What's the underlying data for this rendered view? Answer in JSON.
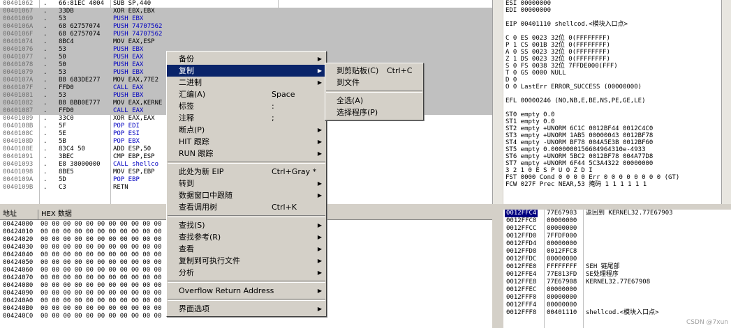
{
  "disasm": {
    "rows": [
      {
        "addr": "00401062",
        "m": ".",
        "hex": "66:81EC 4004",
        "asm": "SUB SP,440",
        "c": "",
        "hl": false
      },
      {
        "addr": "00401067",
        "m": ".",
        "hex": "33DB",
        "asm": "XOR EBX,EBX",
        "c": "",
        "hl": true
      },
      {
        "addr": "00401069",
        "m": ".",
        "hex": "53",
        "asm": "PUSH EBX",
        "c": "blue",
        "hl": true
      },
      {
        "addr": "0040106A",
        "m": ".",
        "hex": "68 62757074",
        "asm": "PUSH 74707562",
        "c": "blue",
        "hl": true
      },
      {
        "addr": "0040106F",
        "m": ".",
        "hex": "68 62757074",
        "asm": "PUSH 74707562",
        "c": "blue",
        "hl": true
      },
      {
        "addr": "00401074",
        "m": ".",
        "hex": "8BC4",
        "asm": "MOV EAX,ESP",
        "c": "",
        "hl": true
      },
      {
        "addr": "00401076",
        "m": ".",
        "hex": "53",
        "asm": "PUSH EBX",
        "c": "blue",
        "hl": true
      },
      {
        "addr": "00401077",
        "m": ".",
        "hex": "50",
        "asm": "PUSH EAX",
        "c": "blue",
        "hl": true
      },
      {
        "addr": "00401078",
        "m": ".",
        "hex": "50",
        "asm": "PUSH EAX",
        "c": "blue",
        "hl": true
      },
      {
        "addr": "00401079",
        "m": ".",
        "hex": "53",
        "asm": "PUSH EBX",
        "c": "blue",
        "hl": true
      },
      {
        "addr": "0040107A",
        "m": ".",
        "hex": "B8 683DE277",
        "asm": "MOV EAX,77E2",
        "c": "",
        "hl": true
      },
      {
        "addr": "0040107F",
        "m": ".",
        "hex": "FFD0",
        "asm": "CALL EAX",
        "c": "blue",
        "hl": true
      },
      {
        "addr": "00401081",
        "m": ".",
        "hex": "53",
        "asm": "PUSH EBX",
        "c": "blue",
        "hl": true
      },
      {
        "addr": "00401082",
        "m": ".",
        "hex": "B8 BBB0E777",
        "asm": "MOV EAX,KERNE",
        "c": "",
        "hl": true
      },
      {
        "addr": "00401087",
        "m": ".",
        "hex": "FFD0",
        "asm": "CALL EAX",
        "c": "blue",
        "hl": true
      },
      {
        "addr": "00401089",
        "m": ".",
        "hex": "33C0",
        "asm": "XOR EAX,EAX",
        "c": "",
        "hl": false
      },
      {
        "addr": "0040108B",
        "m": ".",
        "hex": "5F",
        "asm": "POP EDI",
        "c": "blue",
        "hl": false
      },
      {
        "addr": "0040108C",
        "m": ".",
        "hex": "5E",
        "asm": "POP ESI",
        "c": "blue",
        "hl": false
      },
      {
        "addr": "0040108D",
        "m": ".",
        "hex": "5B",
        "asm": "POP EBX",
        "c": "blue",
        "hl": false
      },
      {
        "addr": "0040108E",
        "m": ".",
        "hex": "83C4 50",
        "asm": "ADD ESP,50",
        "c": "",
        "hl": false
      },
      {
        "addr": "00401091",
        "m": ".",
        "hex": "3BEC",
        "asm": "CMP EBP,ESP",
        "c": "",
        "hl": false
      },
      {
        "addr": "00401093",
        "m": ".",
        "hex": "E8 38000000",
        "asm": "CALL shellco",
        "c": "blue",
        "hl": false
      },
      {
        "addr": "00401098",
        "m": ".",
        "hex": "8BE5",
        "asm": "MOV ESP,EBP",
        "c": "",
        "hl": false
      },
      {
        "addr": "0040109A",
        "m": ".",
        "hex": "5D",
        "asm": "POP EBP",
        "c": "blue",
        "hl": false
      },
      {
        "addr": "0040109B",
        "m": ".",
        "hex": "C3",
        "asm": "RETN",
        "c": "",
        "hl": false
      }
    ]
  },
  "registers": {
    "lines": [
      {
        "t": "ESI 00000000",
        "c": ""
      },
      {
        "t": "EDI 00000000",
        "c": ""
      },
      {
        "t": "",
        "c": ""
      },
      {
        "t": "EIP 00401110 shellcod.<模块入口点>",
        "c": ""
      },
      {
        "t": "",
        "c": ""
      },
      {
        "t": "C 0  ES 0023 32位 0(FFFFFFFF)",
        "c": ""
      },
      {
        "t": "P 1  CS 001B 32位 0(FFFFFFFF)",
        "c": ""
      },
      {
        "t": "A 0  SS 0023 32位 0(FFFFFFFF)",
        "c": ""
      },
      {
        "t": "Z 1  DS 0023 32位 0(FFFFFFFF)",
        "c": ""
      },
      {
        "t": "S 0  FS 0038 32位 7FFDE000(FFF)",
        "c": ""
      },
      {
        "t": "T 0  GS 0000 NULL",
        "c": ""
      },
      {
        "t": "D 0",
        "c": ""
      },
      {
        "t": "O 0  LastErr ERROR_SUCCESS (00000000)",
        "c": ""
      },
      {
        "t": "",
        "c": ""
      },
      {
        "t": "EFL 00000246 (NO,NB,E,BE,NS,PE,GE,LE)",
        "c": ""
      },
      {
        "t": "",
        "c": ""
      },
      {
        "t": "ST0 empty 0.0",
        "c": ""
      },
      {
        "t": "ST1 empty 0.0",
        "c": ""
      },
      {
        "t": "ST2 empty +UNORM 6C1C 0012BF44 0012C4C0",
        "c": ""
      },
      {
        "t": "ST3 empty +UNORM 1AB5 00000043 0012BF78",
        "c": ""
      },
      {
        "t": "ST4 empty -UNORM BF78 004A5E3B 0012BF60",
        "c": ""
      },
      {
        "t": "ST5 empty 0.0000000156604964310e-4933",
        "c": ""
      },
      {
        "t": "ST6 empty +UNORM 5BC2 0012BF78 004A77D8",
        "c": ""
      },
      {
        "t": "ST7 empty +UNORM 6F44 5C3A4322 00000000",
        "c": ""
      },
      {
        "t": "               3 2 1 0      E S P U O Z D I",
        "c": ""
      },
      {
        "t": "FST 0000  Cond 0 0 0 0  Err 0 0 0 0 0 0 0 0  (GT)",
        "c": ""
      },
      {
        "t": "FCW 027F  Prec NEAR,53  掩码    1 1 1 1 1 1",
        "c": ""
      }
    ]
  },
  "dump": {
    "header_addr": "地址",
    "header_hex": "HEX 数据",
    "rows": [
      {
        "addr": "00424000",
        "hex": "00 00 00 00 00 00 00 00 00 00 00"
      },
      {
        "addr": "00424010",
        "hex": "00 00 00 00 00 00 00 00 00 00 00"
      },
      {
        "addr": "00424020",
        "hex": "00 00 00 00 00 00 00 00 00 00 00"
      },
      {
        "addr": "00424030",
        "hex": "00 00 00 00 00 00 00 00 00 00 00"
      },
      {
        "addr": "00424040",
        "hex": "00 00 00 00 00 00 00 00 00 00 00"
      },
      {
        "addr": "00424050",
        "hex": "00 00 00 00 00 00 00 00 00 00 00"
      },
      {
        "addr": "00424060",
        "hex": "00 00 00 00 00 00 00 00 00 00 00"
      },
      {
        "addr": "00424070",
        "hex": "00 00 00 00 00 00 00 00 00 00 00"
      },
      {
        "addr": "00424080",
        "hex": "00 00 00 00 00 00 00 00 00 00 00"
      },
      {
        "addr": "00424090",
        "hex": "00 00 00 00 00 00 00 00 00 00 00"
      },
      {
        "addr": "004240A0",
        "hex": "00 00 00 00 00 00 00 00 00 00 00"
      },
      {
        "addr": "004240B0",
        "hex": "00 00 00 00 00 00 00 00 00 00 00"
      },
      {
        "addr": "004240C0",
        "hex": "00 00 00 00 00 00 00 00 00 00 00"
      }
    ]
  },
  "stack": {
    "rows": [
      {
        "addr": "0012FFC4",
        "val": "77E67903",
        "cmt": "返回到 KERNEL32.77E67903",
        "sel": true
      },
      {
        "addr": "0012FFC8",
        "val": "00000000",
        "cmt": "",
        "sel": false
      },
      {
        "addr": "0012FFCC",
        "val": "00000000",
        "cmt": "",
        "sel": false
      },
      {
        "addr": "0012FFD0",
        "val": "7FFDF000",
        "cmt": "",
        "sel": false
      },
      {
        "addr": "0012FFD4",
        "val": "00000000",
        "cmt": "",
        "sel": false
      },
      {
        "addr": "0012FFD8",
        "val": "0012FFC8",
        "cmt": "",
        "sel": false
      },
      {
        "addr": "0012FFDC",
        "val": "00000000",
        "cmt": "",
        "sel": false
      },
      {
        "addr": "0012FFE0",
        "val": "FFFFFFFF",
        "cmt": "SEH 链尾部",
        "sel": false
      },
      {
        "addr": "0012FFE4",
        "val": "77E813FD",
        "cmt": "SE处理程序",
        "sel": false
      },
      {
        "addr": "0012FFE8",
        "val": "77E67908",
        "cmt": "KERNEL32.77E67908",
        "sel": false
      },
      {
        "addr": "0012FFEC",
        "val": "00000000",
        "cmt": "",
        "sel": false
      },
      {
        "addr": "0012FFF0",
        "val": "00000000",
        "cmt": "",
        "sel": false
      },
      {
        "addr": "0012FFF4",
        "val": "00000000",
        "cmt": "",
        "sel": false
      },
      {
        "addr": "0012FFF8",
        "val": "00401110",
        "cmt": "shellcod.<模块入口点>",
        "sel": false
      }
    ]
  },
  "context_menu": {
    "items": [
      {
        "type": "item",
        "label": "备份",
        "shortcut": "",
        "sub": true,
        "sel": false
      },
      {
        "type": "item",
        "label": "复制",
        "shortcut": "",
        "sub": true,
        "sel": true
      },
      {
        "type": "item",
        "label": "二进制",
        "shortcut": "",
        "sub": true,
        "sel": false
      },
      {
        "type": "item",
        "label": "汇编(A)",
        "shortcut": "Space",
        "sub": false,
        "sel": false
      },
      {
        "type": "item",
        "label": "标签",
        "shortcut": ":",
        "sub": false,
        "sel": false
      },
      {
        "type": "item",
        "label": "注释",
        "shortcut": ";",
        "sub": false,
        "sel": false
      },
      {
        "type": "item",
        "label": "断点(P)",
        "shortcut": "",
        "sub": true,
        "sel": false
      },
      {
        "type": "item",
        "label": "HIT 跟踪",
        "shortcut": "",
        "sub": true,
        "sel": false
      },
      {
        "type": "item",
        "label": "RUN 跟踪",
        "shortcut": "",
        "sub": true,
        "sel": false
      },
      {
        "type": "sep"
      },
      {
        "type": "item",
        "label": "此处为新 EIP",
        "shortcut": "Ctrl+Gray *",
        "sub": false,
        "sel": false
      },
      {
        "type": "item",
        "label": "转到",
        "shortcut": "",
        "sub": true,
        "sel": false
      },
      {
        "type": "item",
        "label": "数据窗口中跟随",
        "shortcut": "",
        "sub": true,
        "sel": false
      },
      {
        "type": "item",
        "label": "查看调用树",
        "shortcut": "Ctrl+K",
        "sub": false,
        "sel": false
      },
      {
        "type": "sep"
      },
      {
        "type": "item",
        "label": "查找(S)",
        "shortcut": "",
        "sub": true,
        "sel": false
      },
      {
        "type": "item",
        "label": "查找参考(R)",
        "shortcut": "",
        "sub": true,
        "sel": false
      },
      {
        "type": "item",
        "label": "查看",
        "shortcut": "",
        "sub": true,
        "sel": false
      },
      {
        "type": "item",
        "label": "复制到可执行文件",
        "shortcut": "",
        "sub": true,
        "sel": false
      },
      {
        "type": "item",
        "label": "分析",
        "shortcut": "",
        "sub": true,
        "sel": false
      },
      {
        "type": "sep"
      },
      {
        "type": "item",
        "label": "Overflow Return Address",
        "shortcut": "",
        "sub": true,
        "sel": false
      },
      {
        "type": "sep"
      },
      {
        "type": "item",
        "label": "界面选项",
        "shortcut": "",
        "sub": true,
        "sel": false
      }
    ]
  },
  "submenu": {
    "items": [
      {
        "type": "item",
        "label": "到剪贴板(C)",
        "shortcut": "Ctrl+C"
      },
      {
        "type": "item",
        "label": "到文件",
        "shortcut": ""
      },
      {
        "type": "sep"
      },
      {
        "type": "item",
        "label": "全选(A)",
        "shortcut": ""
      },
      {
        "type": "item",
        "label": "选择程序(P)",
        "shortcut": ""
      }
    ]
  },
  "watermark": "CSDN @7xun"
}
